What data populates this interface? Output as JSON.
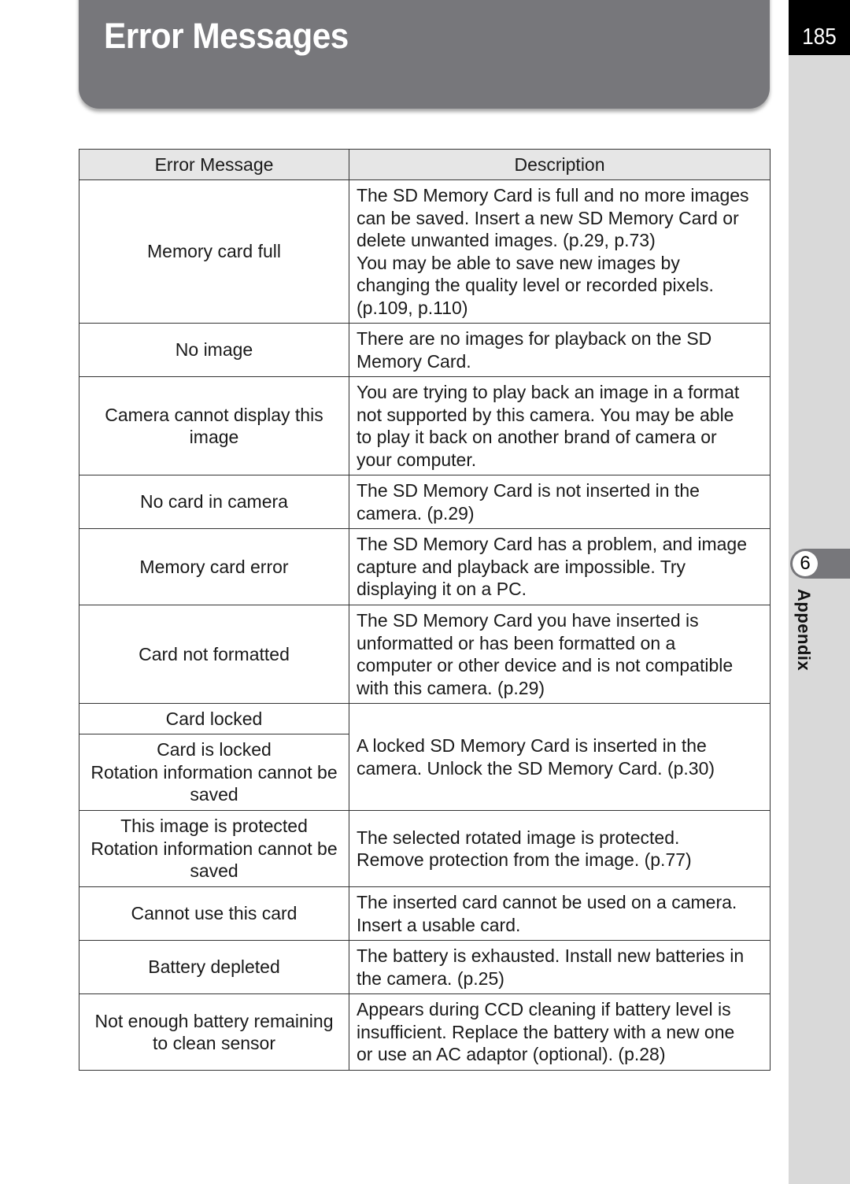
{
  "page": {
    "title": "Error Messages",
    "page_number": "185",
    "chapter_number": "6",
    "chapter_label": "Appendix"
  },
  "table": {
    "headers": [
      "Error Message",
      "Description"
    ],
    "rows": [
      {
        "message": [
          "Memory card full"
        ],
        "description": [
          "The SD Memory Card is full and no more images",
          "can be saved. Insert a new SD Memory Card or",
          "delete unwanted images. (p.29, p.73)",
          "You may be able to save new images by",
          "changing the quality level or recorded pixels.",
          "(p.109, p.110)"
        ]
      },
      {
        "message": [
          "No image"
        ],
        "description": [
          "There are no images for playback on the SD",
          "Memory Card."
        ]
      },
      {
        "message": [
          "Camera cannot display this",
          "image"
        ],
        "description": [
          "You are trying to play back an image in a format",
          "not supported by this camera. You may be able",
          "to play it back on another brand of camera or",
          "your computer."
        ]
      },
      {
        "message": [
          "No card in camera"
        ],
        "description": [
          "The SD Memory Card is not inserted in the",
          "camera. (p.29)"
        ]
      },
      {
        "message": [
          "Memory card error"
        ],
        "description": [
          "The SD Memory Card has a problem, and image",
          "capture and playback are impossible. Try",
          "displaying it on a PC."
        ]
      },
      {
        "message": [
          "Card not formatted"
        ],
        "description": [
          "The SD Memory Card you have inserted is",
          "unformatted or has been formatted on a",
          "computer or other device and is not compatible",
          "with this camera. (p.29)"
        ]
      },
      {
        "message": [
          "Card locked"
        ],
        "description": [
          "A locked SD Memory Card is inserted in the",
          "camera. Unlock the SD Memory Card. (p.30)"
        ]
      },
      {
        "message": [
          "Card is locked",
          "Rotation information cannot be",
          "saved"
        ],
        "description": null
      },
      {
        "message": [
          "This image is protected",
          "Rotation information cannot be",
          "saved"
        ],
        "description": [
          "The selected rotated image is protected.",
          "Remove protection from the image. (p.77)"
        ]
      },
      {
        "message": [
          "Cannot use this card"
        ],
        "description": [
          "The inserted card cannot be used on a camera.",
          "Insert a usable card."
        ]
      },
      {
        "message": [
          "Battery depleted"
        ],
        "description": [
          "The battery is exhausted. Install new batteries in",
          "the camera. (p.25)"
        ]
      },
      {
        "message": [
          "Not enough battery remaining",
          "to clean sensor"
        ],
        "description": [
          "Appears during CCD cleaning if battery level is",
          "insufficient. Replace the battery with a new one",
          "or use an AC adaptor (optional). (p.28)"
        ]
      }
    ]
  },
  "colors": {
    "banner": "#77777b",
    "side_strip": "#d9d9d9",
    "page_number_bg": "#000000",
    "header_row_bg": "#e6e6e6"
  }
}
